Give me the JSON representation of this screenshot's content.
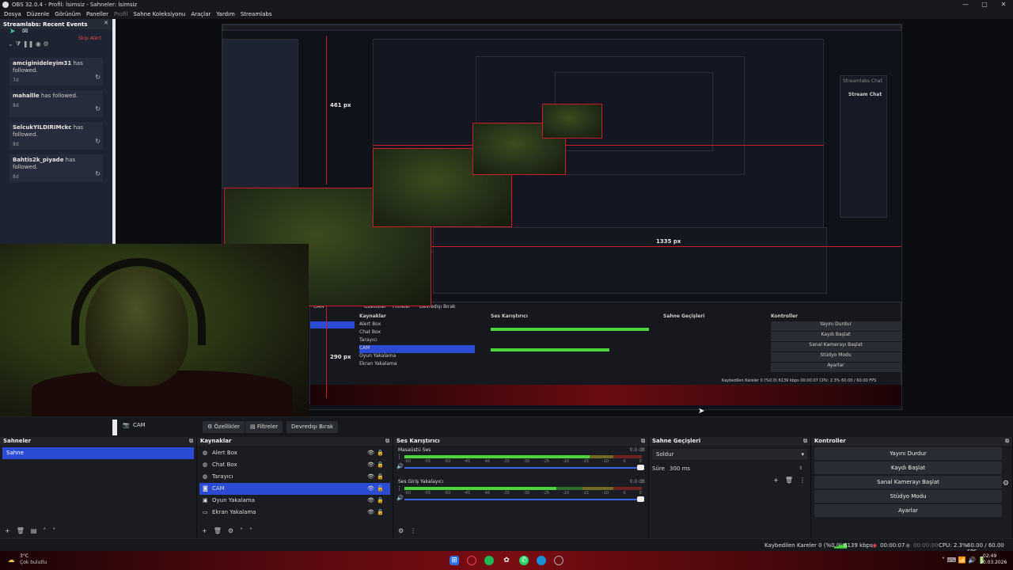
{
  "window": {
    "title": "OBS 32.0.4 - Profil: İsimsiz - Sahneler: İsimsiz",
    "controls": [
      "—",
      "▢",
      "✕"
    ]
  },
  "menu": [
    "Dosya",
    "Düzenle",
    "Görünüm",
    "Paneller",
    "Profil",
    "Sahne Koleksiyonu",
    "Araçlar",
    "Yardım",
    "Streamlabs"
  ],
  "events_panel": {
    "title": "Streamlabs: Recent Events",
    "skip_alert": "Skip Alert",
    "events": [
      {
        "name": "amciginideleyim31",
        "action": "has followed.",
        "age": "7d"
      },
      {
        "name": "mahallle",
        "action": "has followed.",
        "age": "8d"
      },
      {
        "name": "SelcukYILDIRIMckc",
        "action": "has followed.",
        "age": "8d"
      },
      {
        "name": "Bahtis2k_piyade",
        "action": "has followed.",
        "age": "8d"
      }
    ]
  },
  "nested_preview": {
    "measure_height": "461 px",
    "measure_height2": "290 px",
    "measure_width": "1335 px",
    "chat_title": "Streamlabs Chat",
    "chat_button": "Stream Chat",
    "inner_tabs": [
      "CAM",
      "Özellikler",
      "Filtreler",
      "Devredışı Bırak"
    ],
    "inner_docks": [
      "Kaynaklar",
      "Ses Karıştırıcı",
      "Sahne Geçişleri",
      "Kontroller"
    ],
    "inner_sources": [
      "Alert Box",
      "Chat Box",
      "Tarayıcı",
      "CAM",
      "Oyun Yakalama",
      "Ekran Yakalama"
    ],
    "inner_controls": [
      "Yayını Durdur",
      "Kaydı Başlat",
      "Sanal Kamerayı Başlat",
      "Stüdyo Modu",
      "Ayarlar"
    ],
    "inner_status": "Kaybedilen Kareler 0 (%0.0)   6139 kbps   00:00:07   CPU: 2.3%   60.00 / 60.00 FPS"
  },
  "source_bar": {
    "selected": "CAM",
    "properties": "Özellikler",
    "filters": "Filtreler",
    "disable": "Devredışı Bırak"
  },
  "scenes": {
    "title": "Sahneler",
    "items": [
      "Sahne"
    ]
  },
  "sources": {
    "title": "Kaynaklar",
    "items": [
      {
        "name": "Alert Box",
        "icon": "globe-icon"
      },
      {
        "name": "Chat Box",
        "icon": "globe-icon"
      },
      {
        "name": "Tarayıcı",
        "icon": "globe-icon"
      },
      {
        "name": "CAM",
        "icon": "camera-icon"
      },
      {
        "name": "Oyun Yakalama",
        "icon": "gamepad-icon"
      },
      {
        "name": "Ekran Yakalama",
        "icon": "monitor-icon"
      }
    ]
  },
  "mixer": {
    "title": "Ses Karıştırıcı",
    "channels": [
      {
        "name": "Masaüstü Ses",
        "db": "0.0 dB",
        "level": 0.78
      },
      {
        "name": "Ses Giriş Yakalayıcı",
        "db": "0.0 dB",
        "level": 0.64
      }
    ],
    "ticks": [
      "-60",
      "-55",
      "-50",
      "-45",
      "-40",
      "-35",
      "-30",
      "-25",
      "-20",
      "-15",
      "-10",
      "-5",
      "0"
    ]
  },
  "transitions": {
    "title": "Sahne Geçişleri",
    "selected": "Soldur",
    "duration_label": "Süre",
    "duration": "300 ms"
  },
  "controls": {
    "title": "Kontroller",
    "buttons": [
      "Yayını Durdur",
      "Kaydı Başlat",
      "Sanal Kamerayı Başlat",
      "Stüdyo Modu",
      "Ayarlar"
    ]
  },
  "status": {
    "dropped": "Kaybedilen Kareler 0 (%0.0)",
    "bitrate": "6139 kbps",
    "stream_time": "00:00:07",
    "rec_time": "00:00:00",
    "cpu": "CPU: 2.3%",
    "fps": "60.00 / 60.00 FPS"
  },
  "taskbar": {
    "weather_temp": "3°C",
    "weather_desc": "Çok bulutlu",
    "time": "02:49",
    "date": "30.03.2026"
  },
  "colors": {
    "accent": "#2c4bd4",
    "recording_red": "#d01c28",
    "dock_bg": "#1b1c21"
  }
}
